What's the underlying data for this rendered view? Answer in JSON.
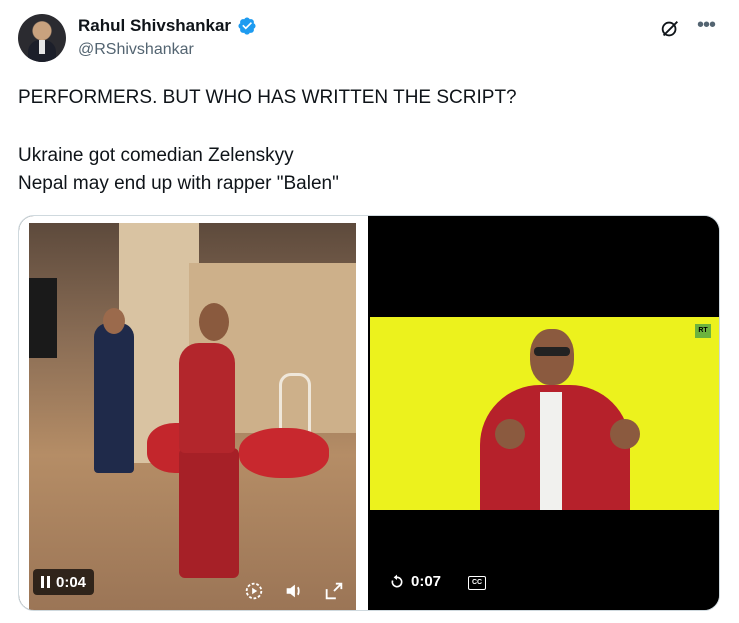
{
  "author": {
    "display_name": "Rahul Shivshankar",
    "handle": "@RShivshankar",
    "verified": true
  },
  "tweet": {
    "line1": "PERFORMERS. BUT WHO HAS WRITTEN THE SCRIPT?",
    "line2": "Ukraine got comedian Zelenskyy",
    "line3": "Nepal may end up with rapper \"Balen\""
  },
  "media": {
    "left_video": {
      "elapsed": "0:04",
      "state": "playing"
    },
    "right_video": {
      "elapsed": "0:07",
      "state": "ended",
      "overlay_logo": "RT"
    }
  },
  "icons": {
    "verified": "verified-badge-icon",
    "grok": "grok-icon",
    "more": "more-options-icon",
    "pause": "pause-icon",
    "playback_speed": "playback-speed-icon",
    "volume": "volume-icon",
    "fullscreen": "fullscreen-icon",
    "replay": "replay-icon",
    "captions": "closed-captions-icon"
  },
  "colors": {
    "accent": "#1d9bf0",
    "text": "#0f1419",
    "secondary": "#536471"
  }
}
